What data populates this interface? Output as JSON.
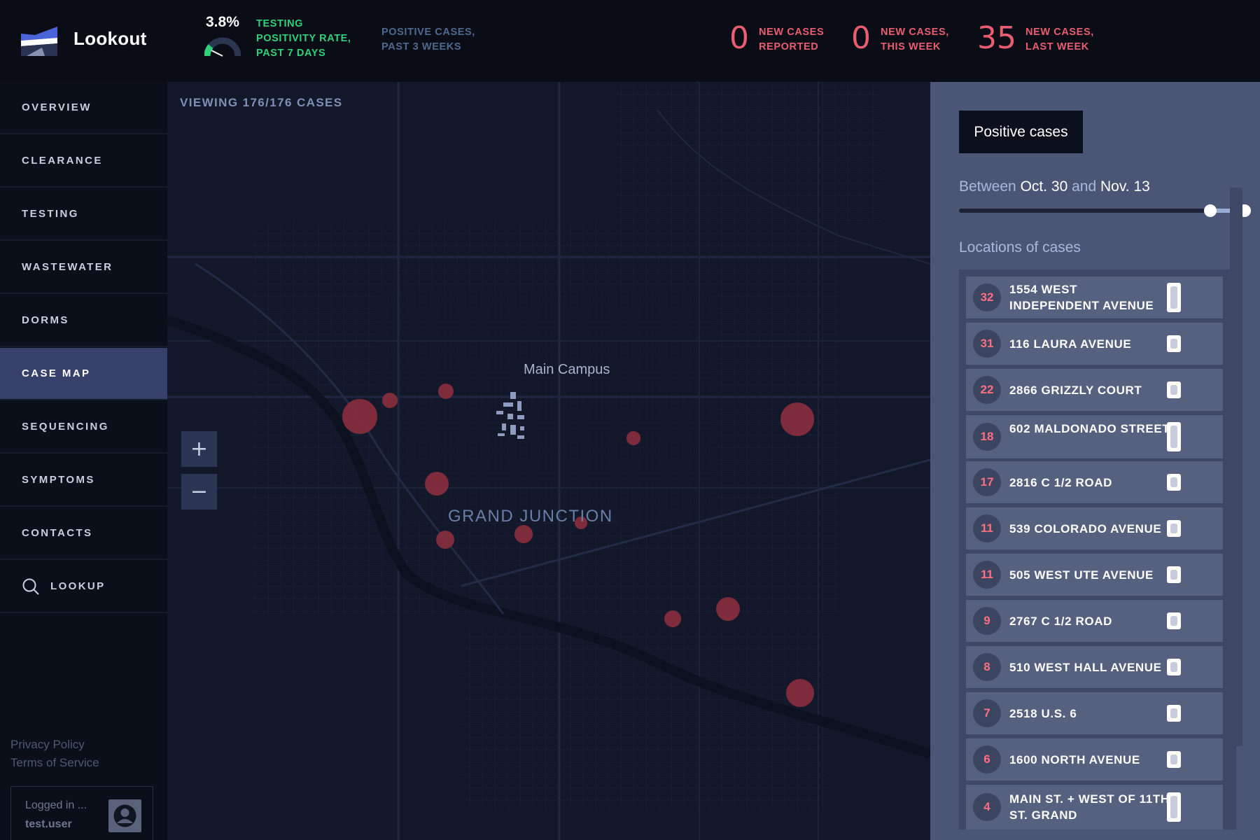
{
  "app": {
    "name": "Lookout"
  },
  "header": {
    "positivity_rate": "3.8%",
    "positivity_label": "Testing positivity rate, past 7 days",
    "positive_cases_label": "Positive cases, past 3 weeks",
    "stats": [
      {
        "value": "0",
        "label_line1": "New cases",
        "label_line2": "reported"
      },
      {
        "value": "0",
        "label_line1": "New cases,",
        "label_line2": "this week"
      },
      {
        "value": "35",
        "label_line1": "New cases,",
        "label_line2": "last week"
      }
    ],
    "colors": {
      "positivity": "#2fd17b",
      "cases": "#e85e70"
    }
  },
  "sidebar": {
    "items": [
      {
        "label": "OVERVIEW"
      },
      {
        "label": "CLEARANCE"
      },
      {
        "label": "TESTING"
      },
      {
        "label": "WASTEWATER"
      },
      {
        "label": "DORMS"
      },
      {
        "label": "CASE MAP",
        "active": true
      },
      {
        "label": "SEQUENCING"
      },
      {
        "label": "SYMPTOMS"
      },
      {
        "label": "CONTACTS"
      },
      {
        "label": "LOOKUP",
        "icon": "search-icon"
      }
    ],
    "footer": {
      "privacy": "Privacy Policy",
      "terms": "Terms of Service"
    },
    "user": {
      "logged_in_label": "Logged in ...",
      "username": "test.user",
      "icon": "user-avatar-icon"
    }
  },
  "map": {
    "viewing_label": "VIEWING 176/176 CASES",
    "campus_label": "Main Campus",
    "city_label": "GRAND JUNCTION",
    "zoom_in": "+",
    "zoom_out": "−",
    "marker_color": "#8b2d3e"
  },
  "panel": {
    "tab_label": "Positive cases",
    "range_prefix": "Between",
    "range_start": "Oct. 30",
    "range_mid": "and",
    "range_end": "Nov. 13",
    "slider_range": [
      0.88,
      1.0
    ],
    "locations_title": "Locations of cases",
    "locations": [
      {
        "count": "32",
        "address": "1554 WEST INDEPENDENT AVENUE"
      },
      {
        "count": "31",
        "address": "116 LAURA AVENUE"
      },
      {
        "count": "22",
        "address": "2866 GRIZZLY COURT"
      },
      {
        "count": "18",
        "address": "602 MALDONADO STREET"
      },
      {
        "count": "17",
        "address": "2816 C 1/2 ROAD"
      },
      {
        "count": "11",
        "address": "539 COLORADO AVENUE"
      },
      {
        "count": "11",
        "address": "505 WEST UTE AVENUE"
      },
      {
        "count": "9",
        "address": "2767 C 1/2 ROAD"
      },
      {
        "count": "8",
        "address": "510 WEST HALL AVENUE"
      },
      {
        "count": "7",
        "address": "2518 U.S. 6"
      },
      {
        "count": "6",
        "address": "1600 NORTH AVENUE"
      },
      {
        "count": "4",
        "address": "MAIN ST. + WEST OF 11TH ST. GRAND"
      }
    ]
  }
}
